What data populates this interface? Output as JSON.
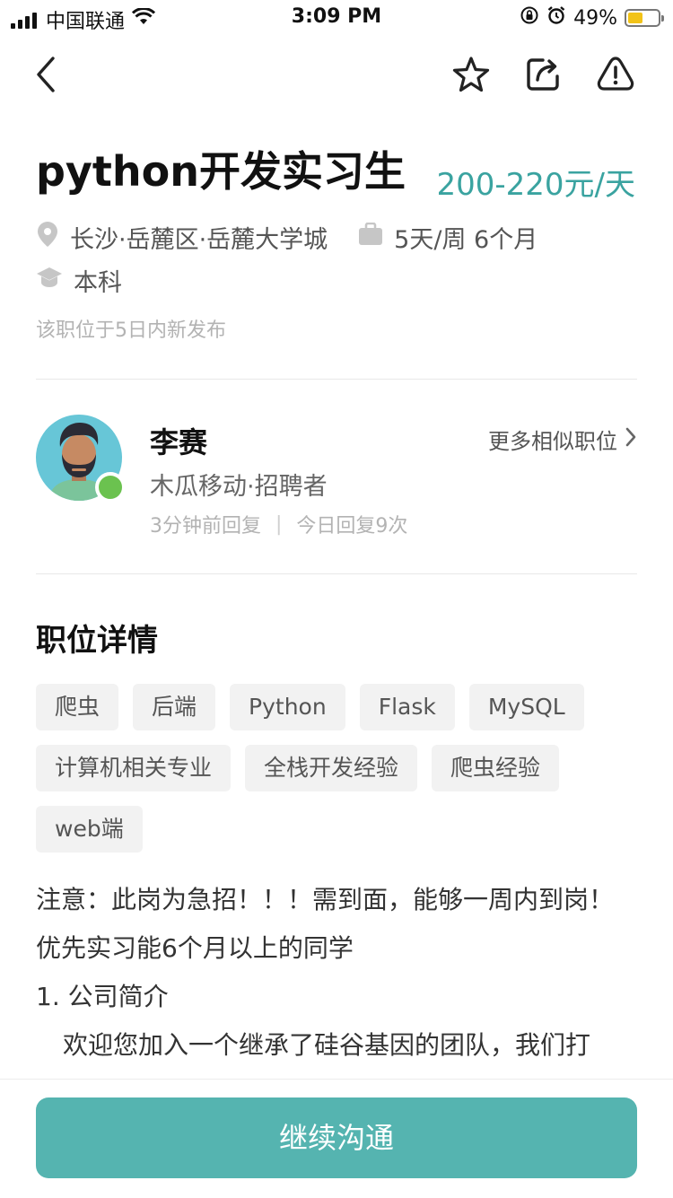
{
  "status_bar": {
    "carrier": "中国联通",
    "time": "3:09 PM",
    "battery": "49%",
    "battery_level": 0.49
  },
  "nav": {
    "back_icon": "chevron-left-icon",
    "favorite_icon": "star-icon",
    "share_icon": "share-icon",
    "report_icon": "warning-icon"
  },
  "job": {
    "title": "python开发实习生",
    "salary": "200-220元/天",
    "location": "长沙·岳麓区·岳麓大学城",
    "schedule": "5天/周 6个月",
    "education": "本科",
    "posted": "该职位于5日内新发布"
  },
  "recruiter": {
    "name": "李赛",
    "company": "木瓜移动·招聘者",
    "reply_time": "3分钟前回复",
    "separator": "|",
    "reply_count": "今日回复9次",
    "similar_jobs": "更多相似职位"
  },
  "details": {
    "section_title": "职位详情",
    "tags": [
      "爬虫",
      "后端",
      "Python",
      "Flask",
      "MySQL",
      "计算机相关专业",
      "全栈开发经验",
      "爬虫经验",
      "web端"
    ],
    "description": [
      "注意：此岗为急招！！！需到面，能够一周内到岗！优先实习能6个月以上的同学",
      "1. 公司简介",
      "欢迎您加入一个继承了硅谷基因的团队，我们打"
    ]
  },
  "actions": {
    "continue_chat": "继续沟通"
  },
  "colors": {
    "accent": "#3aa3a0",
    "button": "#55b4b0",
    "online": "#6bc24f",
    "avatar_bg": "#67c6d7"
  }
}
